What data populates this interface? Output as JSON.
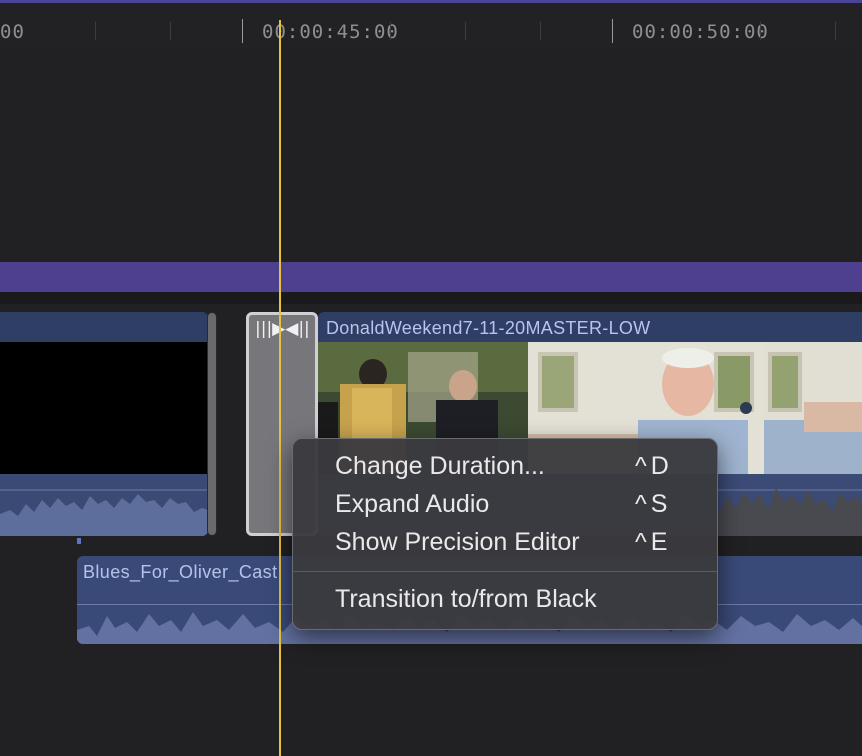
{
  "ruler": {
    "labels": [
      "00",
      "00:00:45:00",
      "00:00:50:00"
    ]
  },
  "clips": {
    "main_title": "DonaldWeekend7-11-20MASTER-LOW",
    "audio_title": "Blues_For_Oliver_Cast",
    "transition_glyph": "|||▶◀||"
  },
  "context_menu": {
    "items": [
      {
        "label": "Change Duration...",
        "shortcut": "^D"
      },
      {
        "label": "Expand Audio",
        "shortcut": "^S"
      },
      {
        "label": "Show Precision Editor",
        "shortcut": "^E"
      },
      {
        "label": "Transition to/from Black",
        "shortcut": ""
      }
    ]
  },
  "colors": {
    "playhead": "#e2c43e",
    "storyline": "#4f3f8f",
    "clip_blue": "#2f3e64"
  }
}
